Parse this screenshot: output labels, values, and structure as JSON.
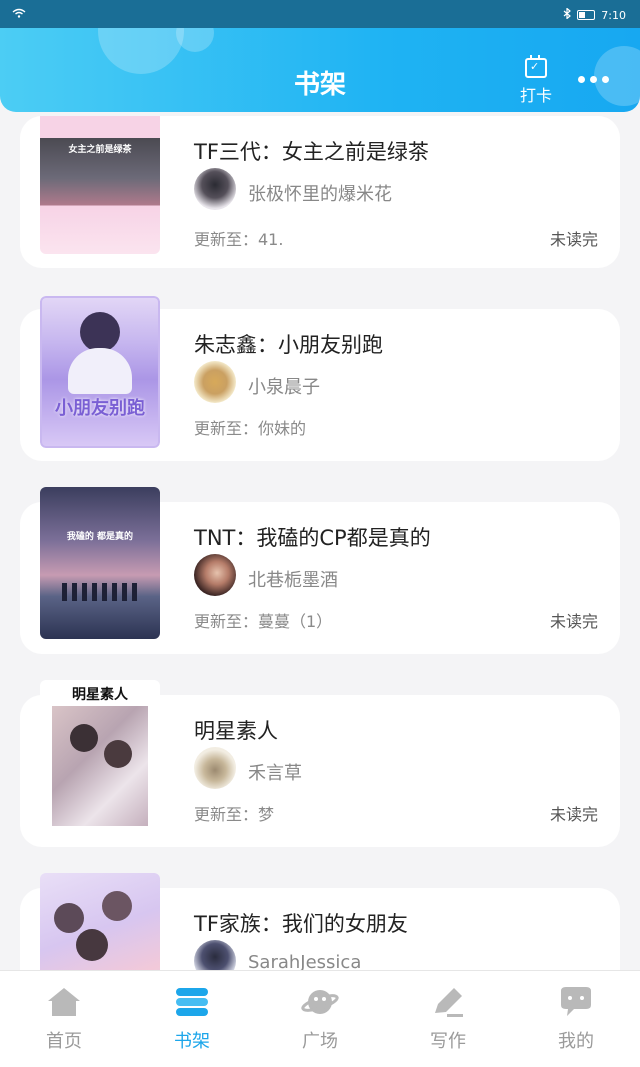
{
  "status_bar": {
    "time": "7:10"
  },
  "header": {
    "title": "书架",
    "checkin_label": "打卡",
    "calendar_glyph": "✓"
  },
  "books": [
    {
      "title": "TF三代：女主之前是绿茶",
      "author": "张极怀里的爆米花",
      "update": "更新至：41.",
      "status": "未读完",
      "cover_text": "女主之前是绿茶"
    },
    {
      "title": "朱志鑫：小朋友别跑",
      "author": "小泉晨子",
      "update": "更新至：你妹的",
      "status": "",
      "cover_text": "小朋友别跑"
    },
    {
      "title": "TNT：我磕的CP都是真的",
      "author": "北巷栀墨酒",
      "update": "更新至：蔓蔓（1）",
      "status": "未读完",
      "cover_text": "我磕的 都是真的"
    },
    {
      "title": "明星素人",
      "author": "禾言草",
      "update": "更新至：梦",
      "status": "未读完",
      "cover_text": "明星素人"
    },
    {
      "title": "TF家族：我们的女朋友",
      "author": "SarahJessica",
      "update": "",
      "status": "",
      "cover_text": ""
    }
  ],
  "nav": [
    {
      "label": "首页",
      "icon": "home-icon"
    },
    {
      "label": "书架",
      "icon": "bookshelf-icon",
      "active": true
    },
    {
      "label": "广场",
      "icon": "planet-icon"
    },
    {
      "label": "写作",
      "icon": "pen-icon"
    },
    {
      "label": "我的",
      "icon": "chat-bubble-icon"
    }
  ],
  "colors": {
    "accent": "#1ca6ea",
    "header_start": "#4ccdf4",
    "header_end": "#17a8f1"
  }
}
